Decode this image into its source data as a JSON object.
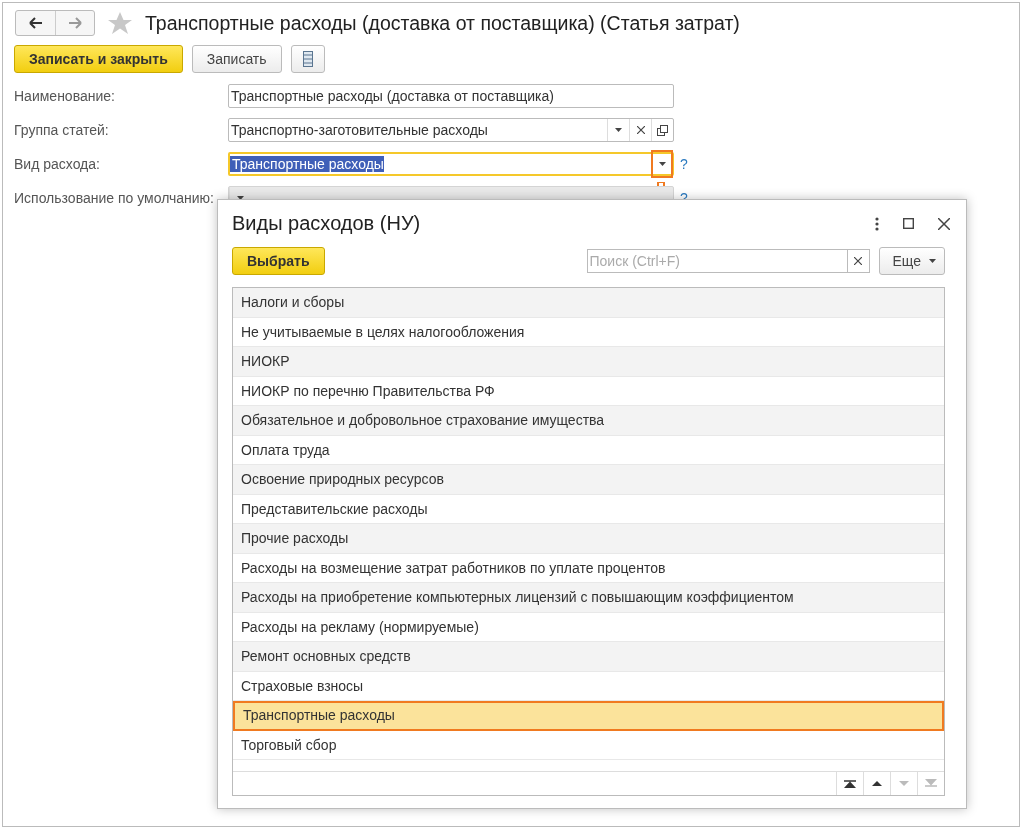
{
  "window": {
    "title": "Транспортные расходы (доставка от поставщика) (Статья затрат)",
    "favorite": false
  },
  "toolbar": {
    "primary": "Записать и закрыть",
    "secondary": "Записать"
  },
  "fields": [
    {
      "label": "Наименование:",
      "value": "Транспортные расходы (доставка от поставщика)",
      "kind": "text",
      "focused": false
    },
    {
      "label": "Группа статей:",
      "value": "Транспортно-заготовительные расходы",
      "kind": "combo",
      "focused": false
    },
    {
      "label": "Вид расхода:",
      "value": "Транспортные расходы",
      "kind": "select",
      "focused": true,
      "highlighted_value": true,
      "help": "?"
    },
    {
      "label": "Использование по умолчанию:",
      "kind": "select",
      "focused": false,
      "disabled": true,
      "help": "?"
    }
  ],
  "popup": {
    "title": "Виды расходов (НУ)",
    "select_button": "Выбрать",
    "search": {
      "placeholder": "Поиск (Ctrl+F)"
    },
    "more_button": "Еще",
    "rows": [
      {
        "label": "Налоги и сборы",
        "selected": false
      },
      {
        "label": "Не учитываемые в целях налогообложения",
        "selected": false
      },
      {
        "label": "НИОКР",
        "selected": false
      },
      {
        "label": "НИОКР по перечню Правительства РФ",
        "selected": false
      },
      {
        "label": "Обязательное и добровольное страхование имущества",
        "selected": false
      },
      {
        "label": "Оплата труда",
        "selected": false
      },
      {
        "label": "Освоение природных ресурсов",
        "selected": false
      },
      {
        "label": "Представительские расходы",
        "selected": false
      },
      {
        "label": "Прочие расходы",
        "selected": false
      },
      {
        "label": "Расходы на возмещение затрат работников по уплате процентов",
        "selected": false
      },
      {
        "label": "Расходы на приобретение компьютерных лицензий с повышающим коэффициентом",
        "selected": false
      },
      {
        "label": "Расходы на рекламу (нормируемые)",
        "selected": false
      },
      {
        "label": "Ремонт основных средств",
        "selected": false
      },
      {
        "label": "Страховые взносы",
        "selected": false
      },
      {
        "label": "Транспортные расходы",
        "selected": true
      },
      {
        "label": "Торговый сбор",
        "selected": false
      }
    ],
    "nav": [
      {
        "kind": "first",
        "disabled": false
      },
      {
        "kind": "up",
        "disabled": false
      },
      {
        "kind": "down",
        "disabled": true
      },
      {
        "kind": "last",
        "disabled": true
      }
    ]
  }
}
